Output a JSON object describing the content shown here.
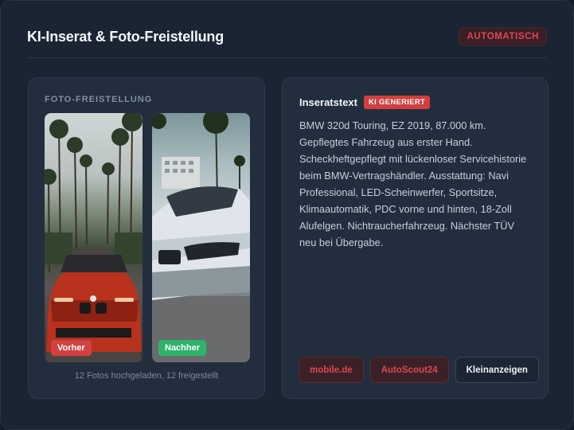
{
  "header": {
    "title": "KI-Inserat & Foto-Freistellung",
    "status_badge": "AUTOMATISCH"
  },
  "photo_panel": {
    "label": "FOTO-FREISTELLUNG",
    "before_tag": "Vorher",
    "after_tag": "Nachher",
    "caption": "12 Fotos hochgeladen, 12 freigestellt"
  },
  "ad_panel": {
    "title": "Inseratstext",
    "badge": "KI GENERIERT",
    "text": "BMW 320d Touring, EZ 2019, 87.000 km. Gepflegtes Fahrzeug aus erster Hand. Scheckheftgepflegt mit lückenloser Servicehistorie beim BMW-Vertragshändler. Ausstattung: Navi Professional, LED-Scheinwerfer, Sportsitze, Klimaautomatik, PDC vorne und hinten, 18-Zoll Alufelgen. Nichtraucherfahrzeug. Nächster TÜV neu bei Übergabe.",
    "buttons": [
      "mobile.de",
      "AutoScout24",
      "Kleinanzeigen"
    ]
  },
  "colors": {
    "accent_red": "#e0454d",
    "success_green": "#2fb36a",
    "background": "#131b27"
  }
}
